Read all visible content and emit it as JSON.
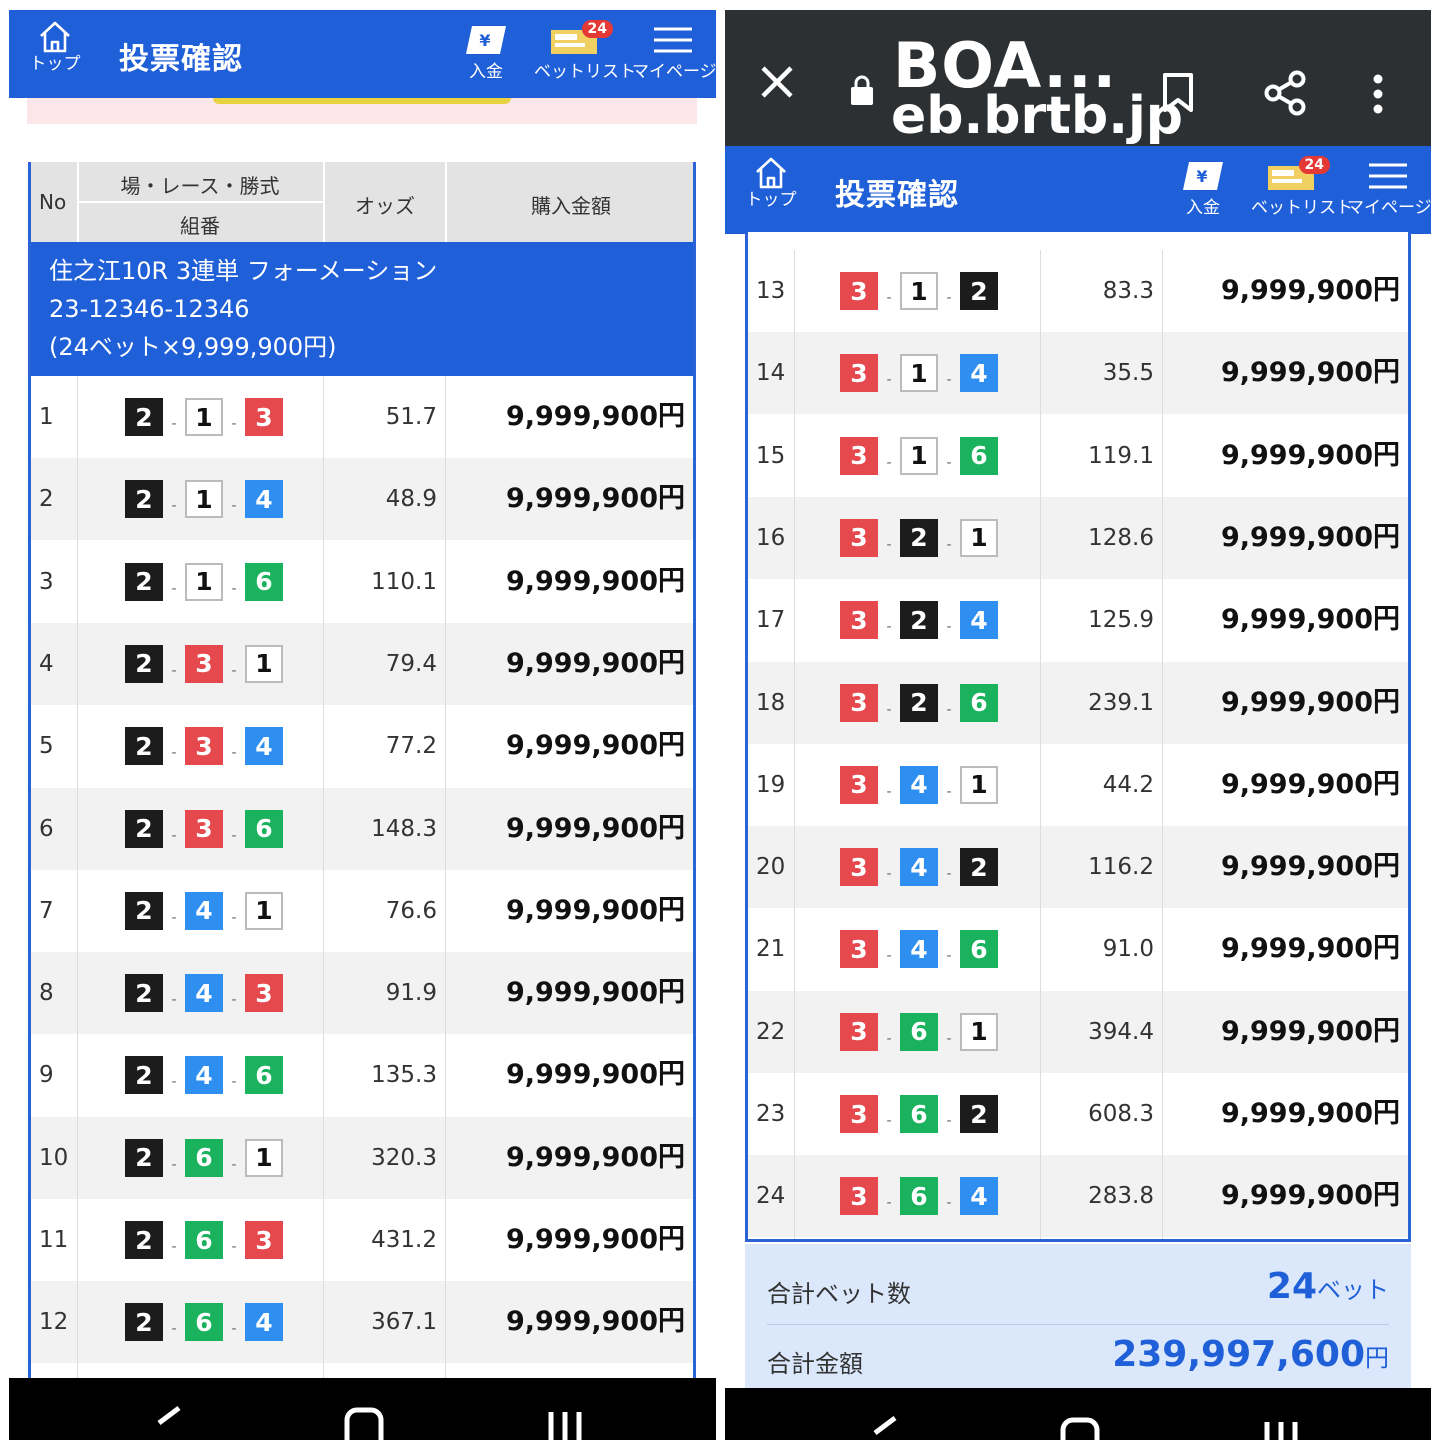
{
  "browser": {
    "host_short": "BOA...",
    "host_domain": "eb.brtb.jp"
  },
  "header": {
    "home_label": "トップ",
    "title": "投票確認",
    "deposit_label": "入金",
    "betlist_label": "ベットリスト",
    "betlist_badge": "24",
    "mypage_label": "マイページ"
  },
  "table_header": {
    "no": "No",
    "race": "場・レース・勝式",
    "combo": "組番",
    "odds": "オッズ",
    "amount": "購入金額"
  },
  "group": {
    "line1": "住之江10R 3連単 フォーメーション",
    "line2": "23-12346-12346",
    "line3": "(24ベット×9,999,900円)"
  },
  "boat_colors": {
    "1": "#ffffff",
    "2": "#1c1c1c",
    "3": "#e5484d",
    "4": "#2f8ff0",
    "6": "#1bb25d"
  },
  "bets": [
    {
      "no": "1",
      "combo": [
        "2",
        "1",
        "3"
      ],
      "odds": "51.7",
      "amount": "9,999,900円"
    },
    {
      "no": "2",
      "combo": [
        "2",
        "1",
        "4"
      ],
      "odds": "48.9",
      "amount": "9,999,900円"
    },
    {
      "no": "3",
      "combo": [
        "2",
        "1",
        "6"
      ],
      "odds": "110.1",
      "amount": "9,999,900円"
    },
    {
      "no": "4",
      "combo": [
        "2",
        "3",
        "1"
      ],
      "odds": "79.4",
      "amount": "9,999,900円"
    },
    {
      "no": "5",
      "combo": [
        "2",
        "3",
        "4"
      ],
      "odds": "77.2",
      "amount": "9,999,900円"
    },
    {
      "no": "6",
      "combo": [
        "2",
        "3",
        "6"
      ],
      "odds": "148.3",
      "amount": "9,999,900円"
    },
    {
      "no": "7",
      "combo": [
        "2",
        "4",
        "1"
      ],
      "odds": "76.6",
      "amount": "9,999,900円"
    },
    {
      "no": "8",
      "combo": [
        "2",
        "4",
        "3"
      ],
      "odds": "91.9",
      "amount": "9,999,900円"
    },
    {
      "no": "9",
      "combo": [
        "2",
        "4",
        "6"
      ],
      "odds": "135.3",
      "amount": "9,999,900円"
    },
    {
      "no": "10",
      "combo": [
        "2",
        "6",
        "1"
      ],
      "odds": "320.3",
      "amount": "9,999,900円"
    },
    {
      "no": "11",
      "combo": [
        "2",
        "6",
        "3"
      ],
      "odds": "431.2",
      "amount": "9,999,900円"
    },
    {
      "no": "12",
      "combo": [
        "2",
        "6",
        "4"
      ],
      "odds": "367.1",
      "amount": "9,999,900円"
    },
    {
      "no": "13",
      "combo": [
        "3",
        "1",
        "2"
      ],
      "odds": "83.3",
      "amount": "9,999,900円"
    },
    {
      "no": "14",
      "combo": [
        "3",
        "1",
        "4"
      ],
      "odds": "35.5",
      "amount": "9,999,900円"
    },
    {
      "no": "15",
      "combo": [
        "3",
        "1",
        "6"
      ],
      "odds": "119.1",
      "amount": "9,999,900円"
    },
    {
      "no": "16",
      "combo": [
        "3",
        "2",
        "1"
      ],
      "odds": "128.6",
      "amount": "9,999,900円"
    },
    {
      "no": "17",
      "combo": [
        "3",
        "2",
        "4"
      ],
      "odds": "125.9",
      "amount": "9,999,900円"
    },
    {
      "no": "18",
      "combo": [
        "3",
        "2",
        "6"
      ],
      "odds": "239.1",
      "amount": "9,999,900円"
    },
    {
      "no": "19",
      "combo": [
        "3",
        "4",
        "1"
      ],
      "odds": "44.2",
      "amount": "9,999,900円"
    },
    {
      "no": "20",
      "combo": [
        "3",
        "4",
        "2"
      ],
      "odds": "116.2",
      "amount": "9,999,900円"
    },
    {
      "no": "21",
      "combo": [
        "3",
        "4",
        "6"
      ],
      "odds": "91.0",
      "amount": "9,999,900円"
    },
    {
      "no": "22",
      "combo": [
        "3",
        "6",
        "1"
      ],
      "odds": "394.4",
      "amount": "9,999,900円"
    },
    {
      "no": "23",
      "combo": [
        "3",
        "6",
        "2"
      ],
      "odds": "608.3",
      "amount": "9,999,900円"
    },
    {
      "no": "24",
      "combo": [
        "3",
        "6",
        "4"
      ],
      "odds": "283.8",
      "amount": "9,999,900円"
    }
  ],
  "totals": {
    "count_label": "合計ベット数",
    "count_value": "24",
    "count_unit": "ベット",
    "amount_label": "合計金額",
    "amount_value": "239,997,600",
    "amount_unit": "円"
  }
}
